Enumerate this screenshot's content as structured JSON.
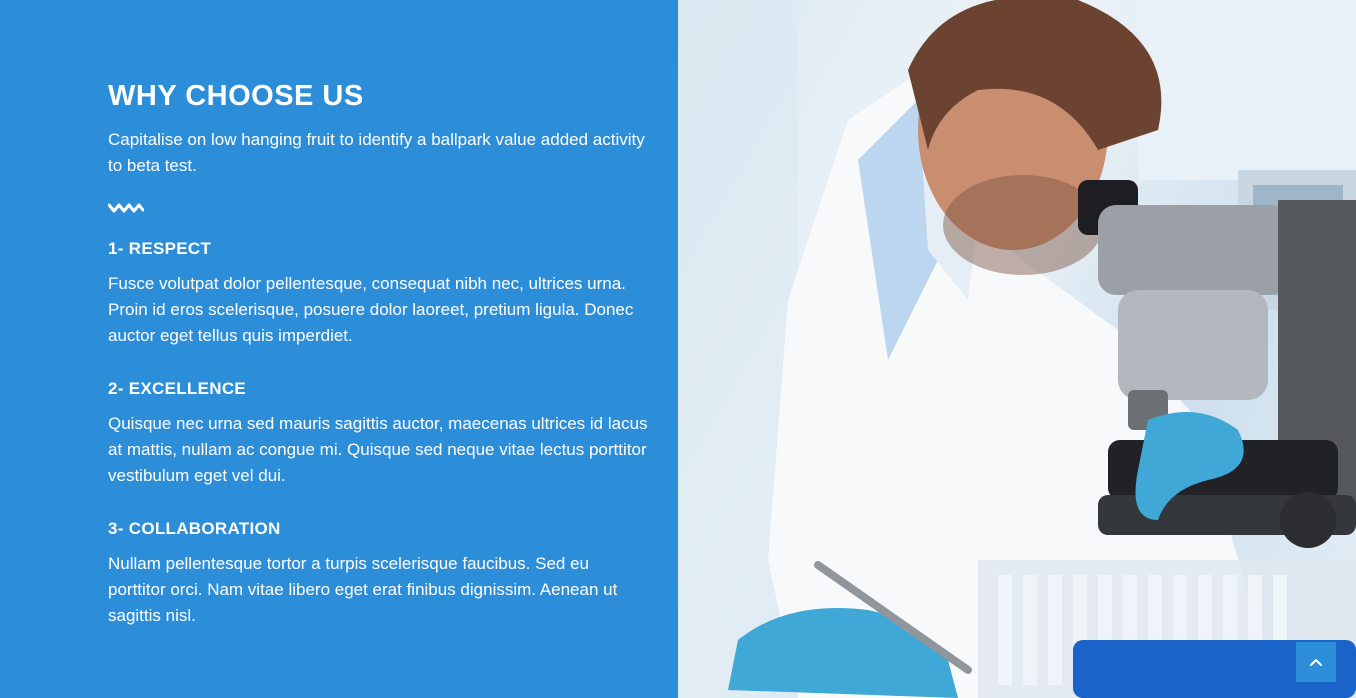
{
  "section": {
    "title": "WHY CHOOSE US",
    "intro": "Capitalise on low hanging fruit to identify a ballpark value added activity to beta test."
  },
  "items": [
    {
      "title": "1- RESPECT",
      "text": "Fusce volutpat dolor pellentesque, consequat nibh nec, ultrices urna. Proin id eros scelerisque, posuere dolor laoreet, pretium ligula. Donec auctor eget tellus quis imperdiet."
    },
    {
      "title": "2- EXCELLENCE",
      "text": "Quisque nec urna sed mauris sagittis auctor, maecenas ultrices id lacus at mattis, nullam ac congue mi. Quisque sed neque vitae lectus porttitor vestibulum eget vel dui."
    },
    {
      "title": "3- COLLABORATION",
      "text": "Nullam pellentesque tortor a turpis scelerisque faucibus. Sed eu porttitor orci. Nam vitae libero eget erat finibus dignissim. Aenean ut sagittis nisl."
    }
  ],
  "colors": {
    "accent": "#2c8dd8",
    "text": "#ffffff"
  },
  "icons": {
    "divider": "wave-divider-icon",
    "back_to_top": "chevron-up-icon"
  }
}
